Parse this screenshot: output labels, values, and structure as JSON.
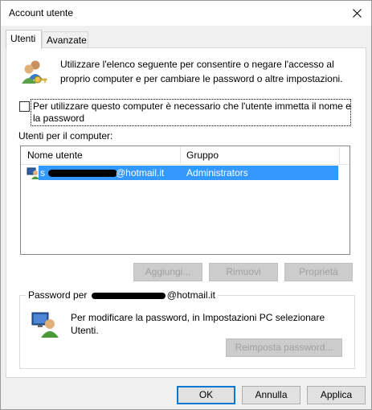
{
  "window": {
    "title": "Account utente",
    "close_glyph": "✕"
  },
  "tabs": [
    {
      "label": "Utenti"
    },
    {
      "label": "Avanzate"
    }
  ],
  "intro": {
    "icon": "users-keys-icon",
    "text": "Utilizzare l'elenco seguente per consentire o negare l'accesso al proprio computer e per cambiare le password o altre impostazioni."
  },
  "login_checkbox": {
    "checked": false,
    "label": "Per utilizzare questo computer è necessario che l'utente immetta il nome e la password"
  },
  "users_list": {
    "label": "Utenti per il computer:",
    "columns": [
      "Nome utente",
      "Gruppo"
    ],
    "rows": [
      {
        "user_icon": "user-icon",
        "name": "s...@hotmail.it",
        "name_visible_suffix": "@hotmail.it",
        "group": "Administrators",
        "selected": true
      }
    ]
  },
  "list_buttons": {
    "add": "Aggiungi...",
    "remove": "Rimuovi",
    "properties": "Proprietà"
  },
  "password_group": {
    "title_prefix": "Password per",
    "title_suffix": "@hotmail.it",
    "icon": "user-monitor-icon",
    "text": "Per modificare la password, in Impostazioni PC selezionare Utenti.",
    "reset_button": "Reimposta password..."
  },
  "dialog_buttons": {
    "ok": "OK",
    "cancel": "Annulla",
    "apply": "Applica"
  },
  "colors": {
    "selection": "#3399ff",
    "focus_border": "#0078d7",
    "window_bg": "#f0f0f0"
  }
}
